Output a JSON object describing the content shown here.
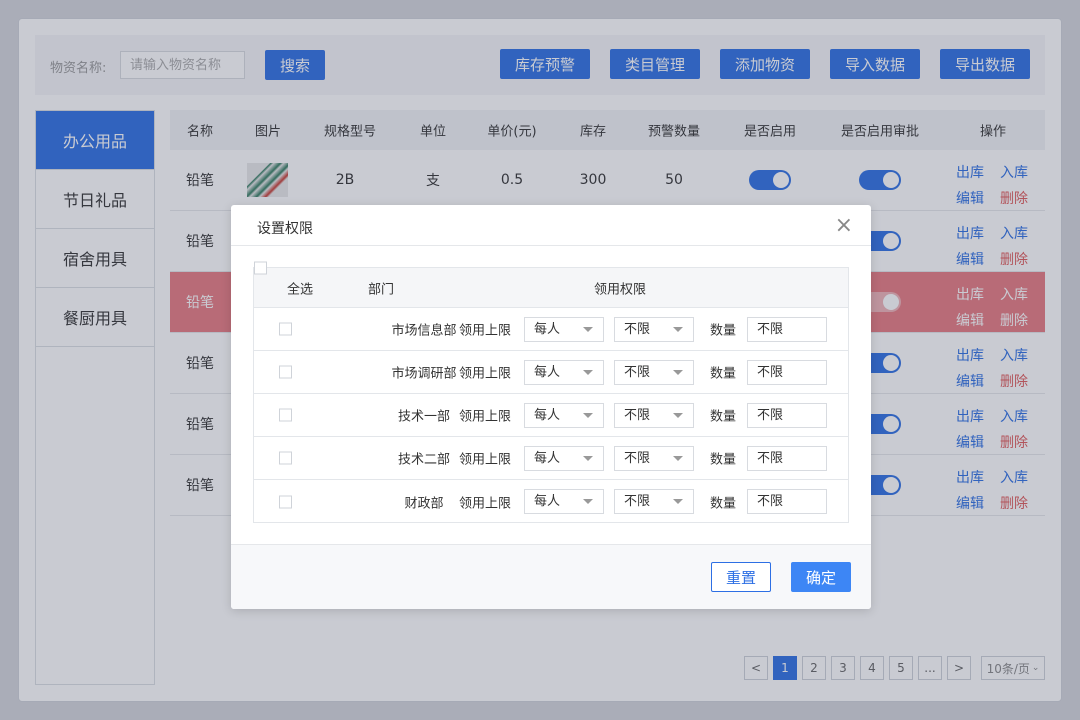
{
  "toolbar": {
    "search_label": "物资名称:",
    "search_placeholder": "请输入物资名称",
    "search_button": "搜索",
    "buttons": [
      "库存预警",
      "类目管理",
      "添加物资",
      "导入数据",
      "导出数据"
    ]
  },
  "sidebar": {
    "items": [
      "办公用品",
      "节日礼品",
      "宿舍用具",
      "餐厨用具"
    ]
  },
  "table": {
    "headers": [
      "名称",
      "图片",
      "规格型号",
      "单位",
      "单价(元)",
      "库存",
      "预警数量",
      "是否启用",
      "是否启用审批",
      "操作"
    ],
    "first_row": {
      "name": "铅笔",
      "spec": "2B",
      "unit": "支",
      "price": "0.5",
      "stock": "300",
      "warn": "50"
    },
    "row_names": [
      "铅笔",
      "铅笔",
      "铅笔",
      "铅笔",
      "铅笔",
      "铅笔"
    ],
    "ops": {
      "out": "出库",
      "in": "入库",
      "edit": "编辑",
      "delete": "删除"
    }
  },
  "pagination": {
    "prev": "<",
    "pages": [
      "1",
      "2",
      "3",
      "4",
      "5",
      "..."
    ],
    "next": ">",
    "page_size": "10条/页"
  },
  "modal": {
    "title": "设置权限",
    "close": "×",
    "select_all": "全选",
    "col_dept": "部门",
    "col_perm": "领用权限",
    "limit_label": "领用上限",
    "qty_label": "数量",
    "rows": [
      {
        "dept": "市场信息部",
        "per": "每人",
        "limit": "不限",
        "qty": "不限"
      },
      {
        "dept": "市场调研部",
        "per": "每人",
        "limit": "不限",
        "qty": "不限"
      },
      {
        "dept": "技术一部",
        "per": "每人",
        "limit": "不限",
        "qty": "不限"
      },
      {
        "dept": "技术二部",
        "per": "每人",
        "limit": "不限",
        "qty": "不限"
      },
      {
        "dept": "财政部",
        "per": "每人",
        "limit": "不限",
        "qty": "不限"
      }
    ],
    "reset": "重置",
    "confirm": "确定"
  },
  "colors": {
    "primary": "#2d6fe4",
    "danger": "#e05a5a",
    "highlight_row": "#e87b82"
  }
}
